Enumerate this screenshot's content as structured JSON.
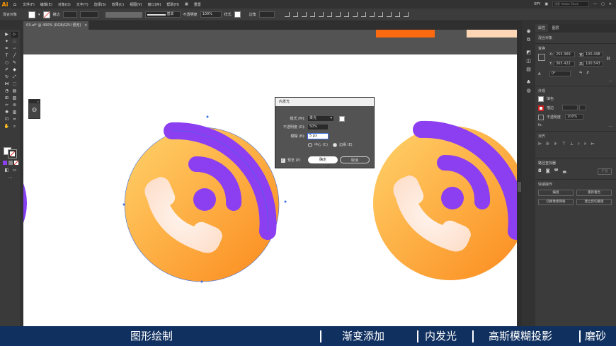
{
  "app": {
    "logo": "Ai",
    "home_icon": "home-icon"
  },
  "menu": {
    "items": [
      "文件(F)",
      "编辑(E)",
      "对象(O)",
      "文字(T)",
      "选择(S)",
      "效果(C)",
      "视图(V)",
      "窗口(W)",
      "帮助(H)"
    ],
    "layout_label": "重置",
    "user": "XPY",
    "search_placeholder": "搜索 Adobe Stock"
  },
  "control": {
    "selection_label": "混合对象",
    "stroke_label": "描边",
    "stroke_style": "基本",
    "opacity_label": "不透明度",
    "opacity_value": "100%",
    "style_label": "样式",
    "corner_label": "边角"
  },
  "document": {
    "tab_title": "03.ai* @ 400% (RGB/GPU 预览)"
  },
  "properties": {
    "tabs": [
      "属性",
      "图层"
    ],
    "selection": "混合对象",
    "transform_title": "变换",
    "x_label": "X:",
    "x_value": "255.369",
    "y_label": "Y:",
    "y_value": "365.422",
    "w_label": "宽:",
    "w_value": "100.498",
    "h_label": "高:",
    "h_value": "100.543",
    "angle_value": "0°",
    "appearance_title": "外观",
    "fill_label": "填色",
    "stroke_label": "描边",
    "opacity_label": "不透明度",
    "opacity_value": "100%",
    "fx_label": "fx.",
    "align_title": "对齐",
    "pathfinder_title": "路径查找器",
    "expand_label": "扩展",
    "quick_title": "快速操作",
    "quick_buttons": [
      "编组",
      "重新着色",
      "切换像素网格",
      "建立剪切蒙版"
    ]
  },
  "dialog": {
    "title": "内发光",
    "mode_label": "模式 (M):",
    "mode_value": "柔光",
    "opacity_label": "不透明度 (O):",
    "opacity_value": "50%",
    "blur_label": "模糊 (B):",
    "blur_value": "5 px",
    "center_label": "中心 (C)",
    "edge_label": "边缘 (E)",
    "preview_label": "预览 (P)",
    "ok_label": "确定",
    "cancel_label": "取消"
  },
  "colors": {
    "orange": "#fb8c1e",
    "purple": "#8c3ff0",
    "caption_bg": "#10305f",
    "selection": "#3b6ee6"
  },
  "caption": {
    "items": [
      "图形绘制",
      "渐变添加",
      "内发光",
      "高斯模糊投影",
      "磨砂"
    ]
  }
}
